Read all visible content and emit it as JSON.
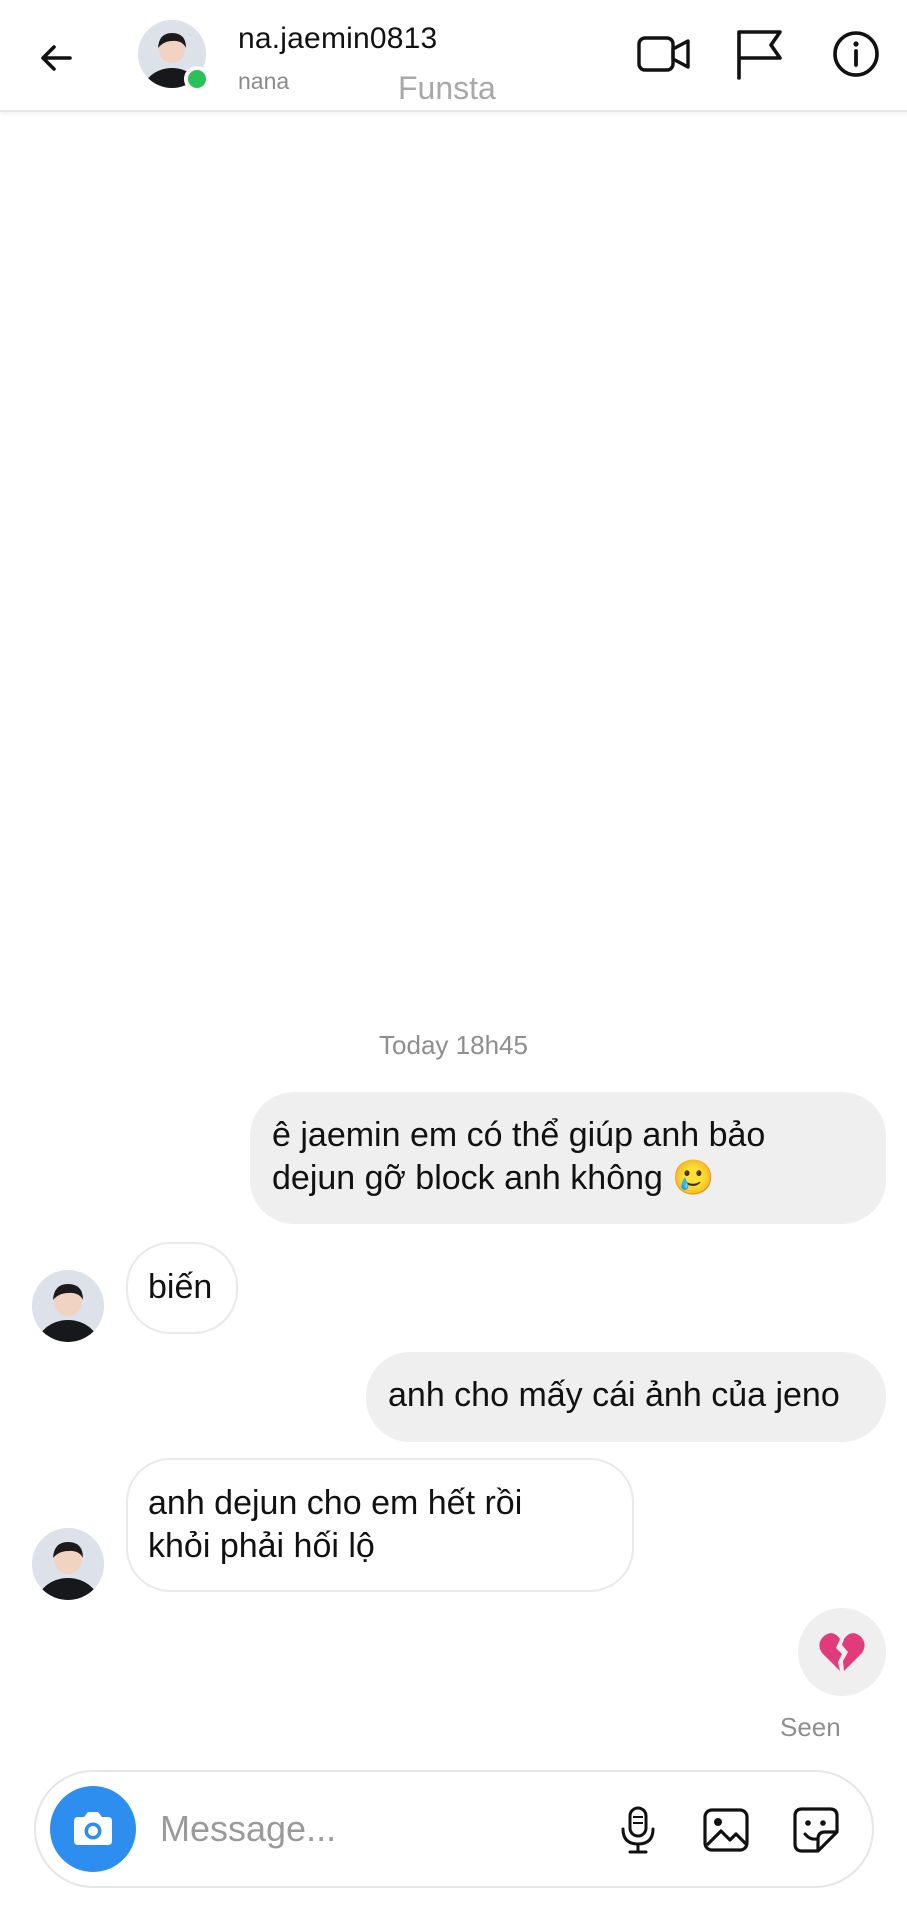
{
  "header": {
    "username": "na.jaemin0813",
    "subname": "nana",
    "overlay_text": "Funsta",
    "online_color": "#2ac05a",
    "icons": [
      "back-arrow-icon",
      "video-call-icon",
      "flag-icon",
      "info-icon"
    ]
  },
  "conversation": {
    "timestamp": "Today 18h45",
    "messages": [
      {
        "direction": "outgoing",
        "line1": "ê jaemin em có thể giúp anh bảo",
        "line2": "dejun gỡ block anh không 🥲"
      },
      {
        "direction": "incoming",
        "text": "biến"
      },
      {
        "direction": "outgoing",
        "text": "anh cho mấy cái ảnh của jeno"
      },
      {
        "direction": "incoming",
        "line1": "anh dejun cho em hết rồi",
        "line2": "khỏi phải hối lộ"
      },
      {
        "direction": "outgoing",
        "text": "💔"
      }
    ],
    "seen_label": "Seen"
  },
  "composer": {
    "placeholder": "Message...",
    "camera_color": "#2d8ef0",
    "icons": [
      "camera-icon",
      "microphone-icon",
      "gallery-icon",
      "sticker-icon"
    ]
  }
}
